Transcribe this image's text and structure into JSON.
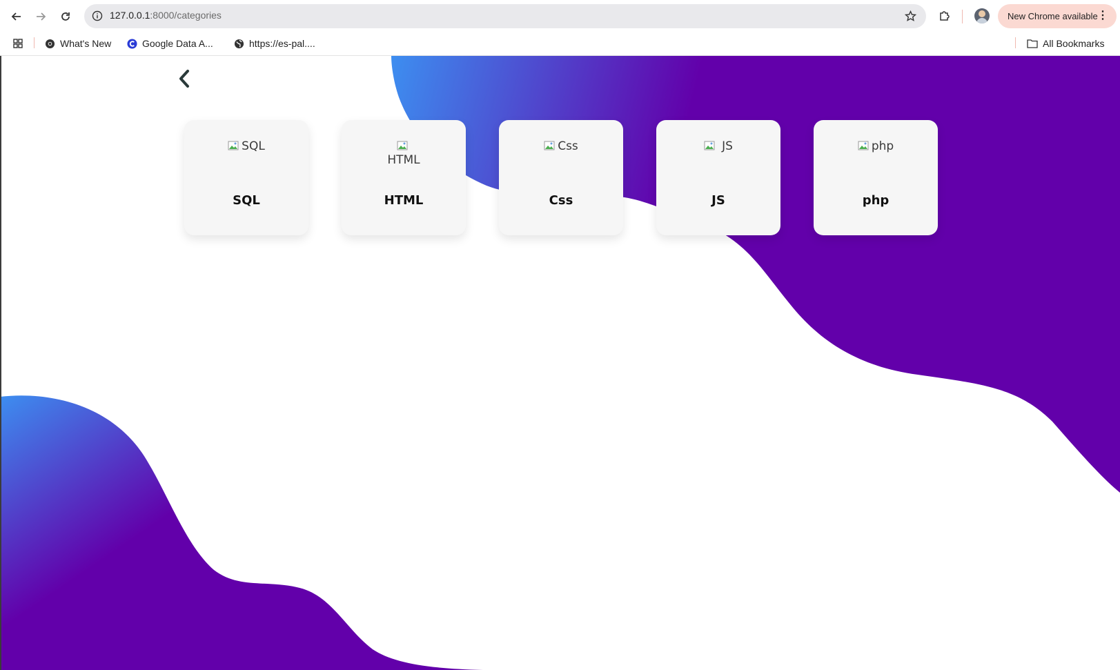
{
  "browser": {
    "url_host": "127.0.0.1",
    "url_path": ":8000/categories",
    "update_label": "New Chrome available",
    "bookmarks": [
      {
        "label": "What's New",
        "icon": "chrome-icon"
      },
      {
        "label": "Google Data A...",
        "icon": "google-c-icon"
      },
      {
        "label": "https://es-pal....",
        "icon": "globe-icon"
      }
    ],
    "all_bookmarks_label": "All Bookmarks"
  },
  "page": {
    "gradient": {
      "start": "#3d8ef0",
      "end": "#6200aa"
    },
    "categories": [
      {
        "alt": "SQL",
        "label": "SQL"
      },
      {
        "alt": "HTML",
        "label": "HTML"
      },
      {
        "alt": "Css",
        "label": "Css"
      },
      {
        "alt": "JS",
        "label": "JS"
      },
      {
        "alt": "php",
        "label": "php"
      }
    ]
  }
}
